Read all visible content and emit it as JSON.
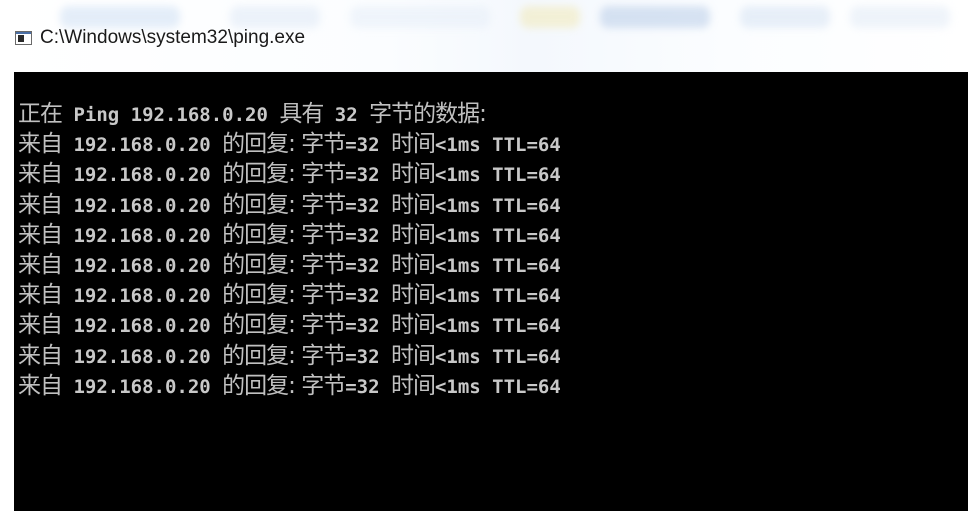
{
  "window": {
    "title": "C:\\Windows\\system32\\ping.exe",
    "icon": "console-window-icon"
  },
  "console": {
    "background": "#000000",
    "foreground": "#c0c0c0",
    "header": {
      "w1": "正在",
      "t1": " Ping 192.168.0.20 ",
      "w2": "具有",
      "t2": " 32 ",
      "w3": "字节的数据:"
    },
    "replies": [
      {
        "w1": "来自",
        "ip": " 192.168.0.20 ",
        "w2": "的回复: 字节",
        "bytes": "=32 ",
        "w3": "时间",
        "time": "<1ms TTL=64"
      },
      {
        "w1": "来自",
        "ip": " 192.168.0.20 ",
        "w2": "的回复: 字节",
        "bytes": "=32 ",
        "w3": "时间",
        "time": "<1ms TTL=64"
      },
      {
        "w1": "来自",
        "ip": " 192.168.0.20 ",
        "w2": "的回复: 字节",
        "bytes": "=32 ",
        "w3": "时间",
        "time": "<1ms TTL=64"
      },
      {
        "w1": "来自",
        "ip": " 192.168.0.20 ",
        "w2": "的回复: 字节",
        "bytes": "=32 ",
        "w3": "时间",
        "time": "<1ms TTL=64"
      },
      {
        "w1": "来自",
        "ip": " 192.168.0.20 ",
        "w2": "的回复: 字节",
        "bytes": "=32 ",
        "w3": "时间",
        "time": "<1ms TTL=64"
      },
      {
        "w1": "来自",
        "ip": " 192.168.0.20 ",
        "w2": "的回复: 字节",
        "bytes": "=32 ",
        "w3": "时间",
        "time": "<1ms TTL=64"
      },
      {
        "w1": "来自",
        "ip": " 192.168.0.20 ",
        "w2": "的回复: 字节",
        "bytes": "=32 ",
        "w3": "时间",
        "time": "<1ms TTL=64"
      },
      {
        "w1": "来自",
        "ip": " 192.168.0.20 ",
        "w2": "的回复: 字节",
        "bytes": "=32 ",
        "w3": "时间",
        "time": "<1ms TTL=64"
      },
      {
        "w1": "来自",
        "ip": " 192.168.0.20 ",
        "w2": "的回复: 字节",
        "bytes": "=32 ",
        "w3": "时间",
        "time": "<1ms TTL=64"
      }
    ]
  }
}
